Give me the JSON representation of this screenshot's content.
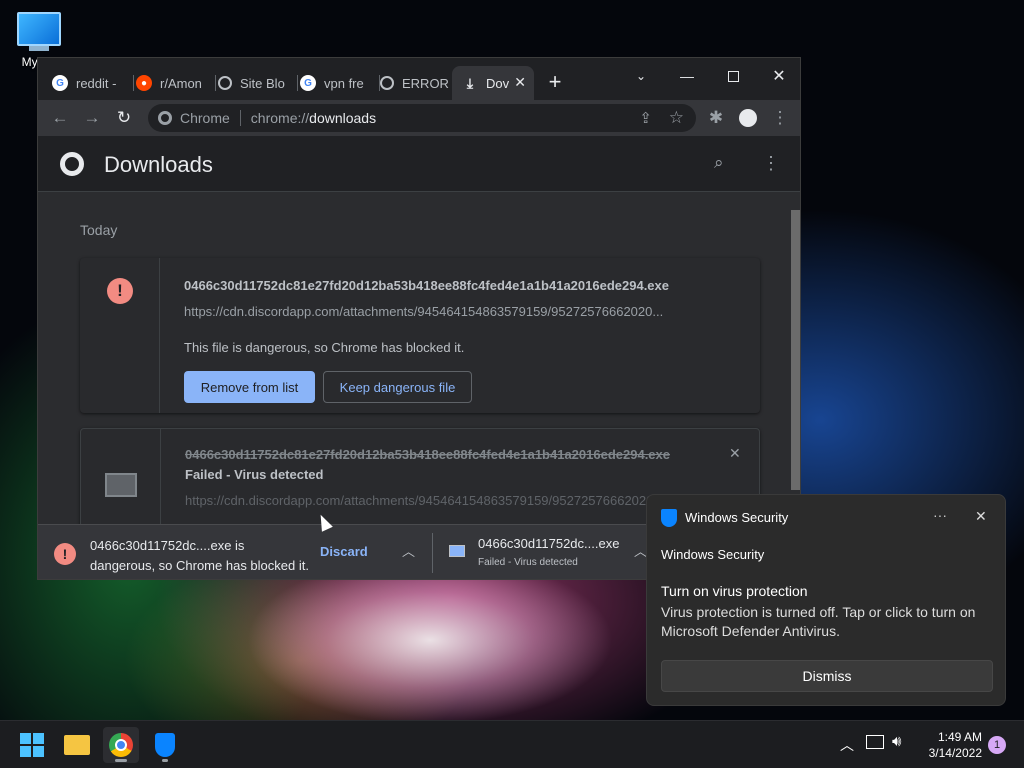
{
  "desktop": {
    "icon_label": "My Co"
  },
  "chrome": {
    "tabs": [
      {
        "label": "reddit -",
        "icon": "google-icon"
      },
      {
        "label": "r/Amon",
        "icon": "reddit-icon"
      },
      {
        "label": "Site Blo",
        "icon": "globe-icon"
      },
      {
        "label": "vpn fre",
        "icon": "google-icon"
      },
      {
        "label": "ERROR:",
        "icon": "globe-icon"
      },
      {
        "label": "Dov",
        "icon": "download-icon"
      }
    ],
    "omnibox": {
      "chip": "Chrome",
      "url_scheme": "chrome://",
      "url_host": "downloads"
    },
    "page": {
      "title": "Downloads",
      "section": "Today",
      "items": [
        {
          "name": "0466c30d11752dc81e27fd20d12ba53b418ee88fc4fed4e1a1b41a2016ede294.exe",
          "url": "https://cdn.discordapp.com/attachments/945464154863579159/95272576662020...",
          "description": "This file is dangerous, so Chrome has blocked it.",
          "primary_button": "Remove from list",
          "secondary_button": "Keep dangerous file"
        },
        {
          "name": "0466c30d11752dc81e27fd20d12ba53b418ee88fc4fed4e1a1b41a2016ede294.exe",
          "status": "Failed - Virus detected",
          "url": "https://cdn.discordapp.com/attachments/945464154863579159/95272576662020..."
        }
      ]
    },
    "shelf": {
      "item1_line1": "0466c30d11752dc....exe is",
      "item1_line2": "dangerous, so Chrome has blocked it.",
      "discard": "Discard",
      "item2_name": "0466c30d11752dc....exe",
      "item2_status": "Failed - Virus detected"
    }
  },
  "toast": {
    "app": "Windows Security",
    "header": "Windows Security",
    "title": "Turn on virus protection",
    "body": "Virus protection is turned off. Tap or click to turn on Microsoft Defender Antivirus.",
    "dismiss": "Dismiss"
  },
  "taskbar": {
    "time": "1:49 AM",
    "date": "3/14/2022",
    "notification_count": "1"
  },
  "colors": {
    "accent": "#8ab4f8",
    "danger": "#f28b82",
    "chrome_bg": "#202124",
    "card_bg": "#292a2d"
  }
}
